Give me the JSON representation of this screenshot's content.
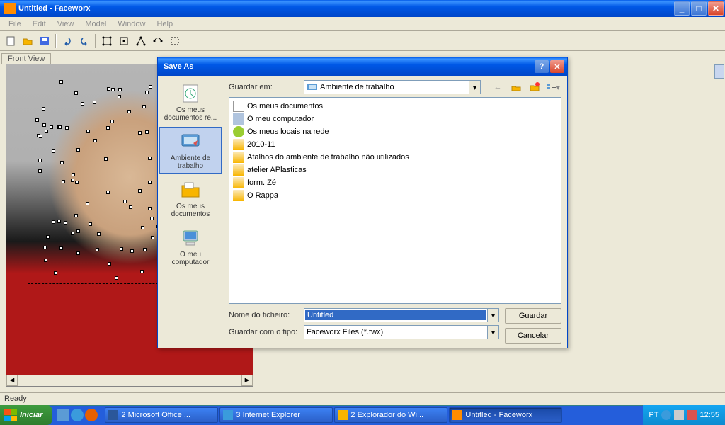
{
  "app": {
    "title": "Untitled - Faceworx",
    "status": "Ready",
    "front_tab": "Front View"
  },
  "menu": [
    "File",
    "Edit",
    "View",
    "Model",
    "Window",
    "Help"
  ],
  "dialog": {
    "title": "Save As",
    "save_in_label": "Guardar em:",
    "save_in_value": "Ambiente de trabalho",
    "filename_label": "Nome do ficheiro:",
    "filename_value": "Untitled",
    "filetype_label": "Guardar com o tipo:",
    "filetype_value": "Faceworx Files (*.fwx)",
    "btn_save": "Guardar",
    "btn_cancel": "Cancelar",
    "places": [
      {
        "label": "Os meus documentos re..."
      },
      {
        "label": "Ambiente de trabalho"
      },
      {
        "label": "Os meus documentos"
      },
      {
        "label": "O meu computador"
      }
    ],
    "files": [
      {
        "icon": "doc",
        "label": "Os meus documentos"
      },
      {
        "icon": "comp",
        "label": "O meu computador"
      },
      {
        "icon": "net",
        "label": "Os meus locais na rede"
      },
      {
        "icon": "folder",
        "label": "2010-11"
      },
      {
        "icon": "folder",
        "label": "Atalhos do ambiente de trabalho não utilizados"
      },
      {
        "icon": "folder",
        "label": "atelier APlasticas"
      },
      {
        "icon": "folder",
        "label": "form. Zé"
      },
      {
        "icon": "folder",
        "label": "O Rappa"
      }
    ]
  },
  "taskbar": {
    "start": "Iniciar",
    "tasks": [
      {
        "label": "2 Microsoft Office ...",
        "color": "#2b579a"
      },
      {
        "label": "3 Internet Explorer",
        "color": "#3a9bdc"
      },
      {
        "label": "2 Explorador do Wi...",
        "color": "#f8b500"
      },
      {
        "label": "Untitled - Faceworx",
        "color": "#ff8c00",
        "active": true
      }
    ],
    "lang": "PT",
    "clock": "12:55"
  }
}
